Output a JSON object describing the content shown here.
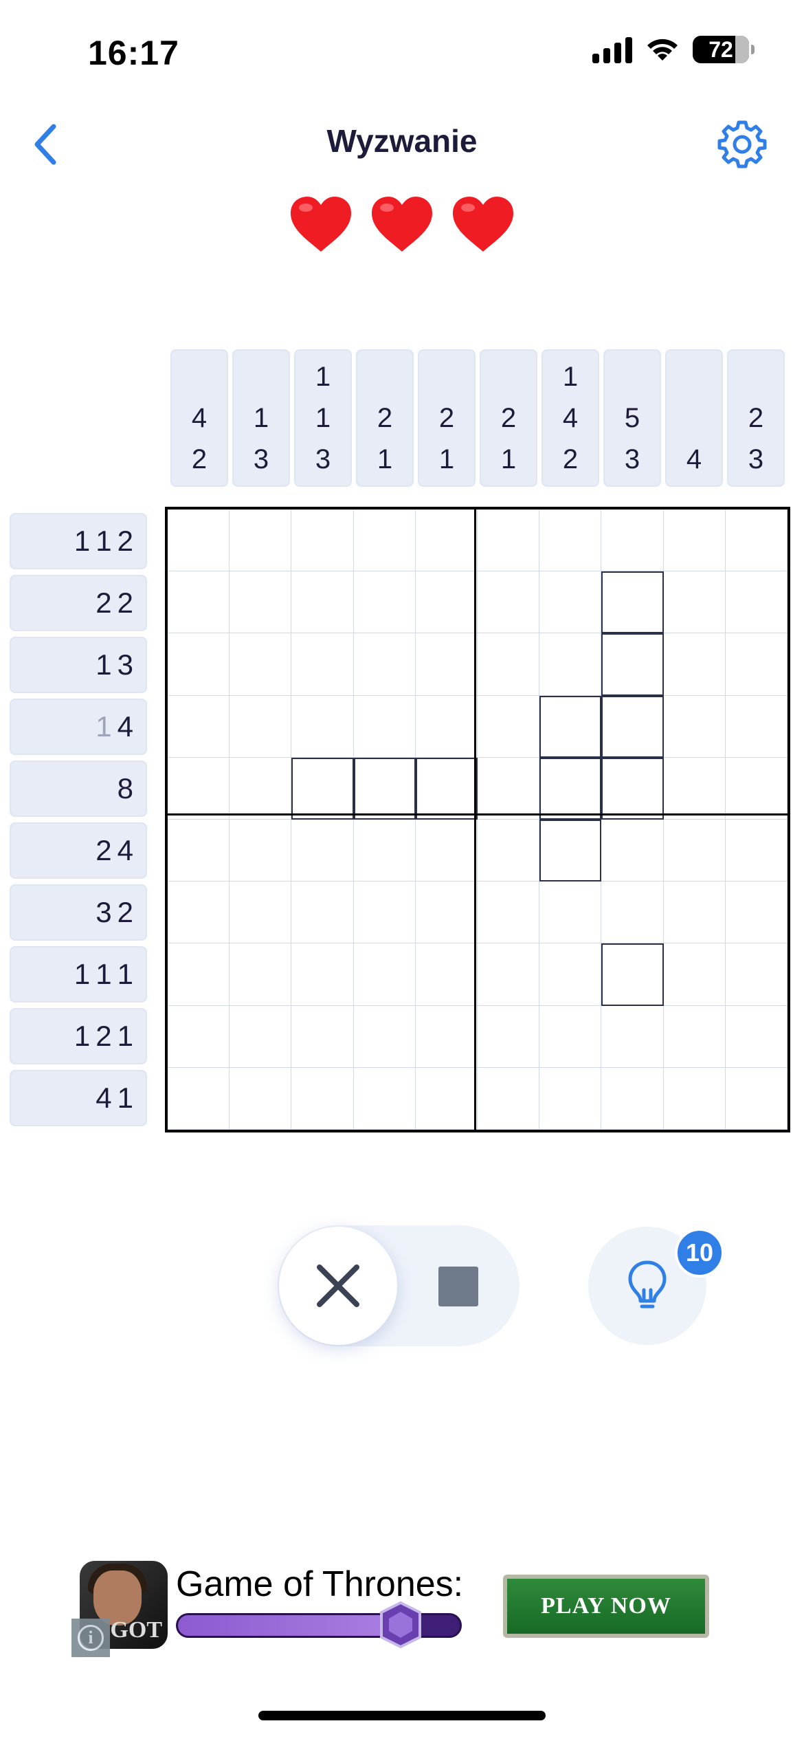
{
  "status_bar": {
    "time": "16:17",
    "battery": "72"
  },
  "header": {
    "title": "Wyzwanie",
    "back_icon": "chevron-left-icon",
    "settings_icon": "gear-icon"
  },
  "lives": {
    "count": 3,
    "icon": "heart-icon",
    "color": "#ef1c24"
  },
  "puzzle": {
    "size": [
      10,
      10
    ],
    "column_clues": [
      [
        "4",
        "2"
      ],
      [
        "1",
        "3"
      ],
      [
        "1",
        "1",
        "3"
      ],
      [
        "2",
        "1"
      ],
      [
        "2",
        "1"
      ],
      [
        "2",
        "1"
      ],
      [
        "1",
        "4",
        "2"
      ],
      [
        "5",
        "3"
      ],
      [
        "4"
      ],
      [
        "2",
        "3"
      ]
    ],
    "row_clues": [
      [
        {
          "v": "1"
        },
        {
          "v": "1"
        },
        {
          "v": "2"
        }
      ],
      [
        {
          "v": "2"
        },
        {
          "v": "2"
        }
      ],
      [
        {
          "v": "1"
        },
        {
          "v": "3"
        }
      ],
      [
        {
          "v": "1",
          "done": true
        },
        {
          "v": "4"
        }
      ],
      [
        {
          "v": "8"
        }
      ],
      [
        {
          "v": "2"
        },
        {
          "v": "4"
        }
      ],
      [
        {
          "v": "3"
        },
        {
          "v": "2"
        }
      ],
      [
        {
          "v": "1"
        },
        {
          "v": "1"
        },
        {
          "v": "1"
        }
      ],
      [
        {
          "v": "1"
        },
        {
          "v": "2"
        },
        {
          "v": "1"
        }
      ],
      [
        {
          "v": "4"
        },
        {
          "v": "1"
        }
      ]
    ],
    "marked_cells": [
      [
        1,
        7
      ],
      [
        2,
        7
      ],
      [
        3,
        6
      ],
      [
        3,
        7
      ],
      [
        4,
        2
      ],
      [
        4,
        3
      ],
      [
        4,
        4
      ],
      [
        4,
        6
      ],
      [
        4,
        7
      ],
      [
        5,
        6
      ],
      [
        7,
        7
      ]
    ]
  },
  "controls": {
    "mode_cross_icon": "cross-icon",
    "mode_fill_icon": "filled-square-icon",
    "hint_icon": "lightbulb-icon",
    "hint_count": "10",
    "accent": "#2f7fe6"
  },
  "ad": {
    "title": "Game of Thrones:",
    "icon_brand": "GOT",
    "cta": "PLAY NOW",
    "progress": 0.72,
    "info_icon": "info-icon"
  }
}
